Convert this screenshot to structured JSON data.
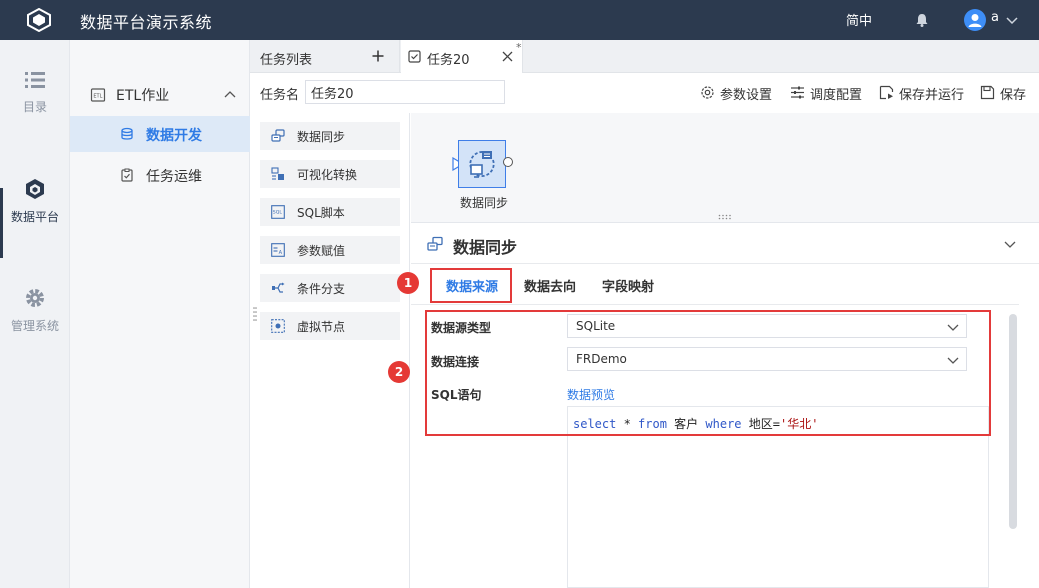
{
  "header": {
    "app_title": "数据平台演示系统",
    "lang": "简中",
    "user": "a"
  },
  "rail": {
    "items": [
      {
        "label": "目录",
        "icon": "list-icon"
      },
      {
        "label": "数据平台",
        "icon": "cube-icon",
        "active": true
      },
      {
        "label": "管理系统",
        "icon": "gear-icon"
      }
    ]
  },
  "sidebar": {
    "group": "ETL作业",
    "items": [
      {
        "label": "数据开发",
        "active": true
      },
      {
        "label": "任务运维"
      }
    ]
  },
  "tabs": {
    "list_label": "任务列表",
    "task_label": "任务20",
    "modified_mark": "*"
  },
  "toolbar": {
    "name_label": "任务名",
    "name_value": "任务20",
    "params_label": "参数设置",
    "schedule_label": "调度配置",
    "save_run_label": "保存并运行",
    "save_label": "保存"
  },
  "palette": {
    "items": [
      {
        "label": "数据同步",
        "icon": "data-sync-icon"
      },
      {
        "label": "可视化转换",
        "icon": "visual-transform-icon"
      },
      {
        "label": "SQL脚本",
        "icon": "sql-icon"
      },
      {
        "label": "参数赋值",
        "icon": "param-assign-icon"
      },
      {
        "label": "条件分支",
        "icon": "branch-icon"
      },
      {
        "label": "虚拟节点",
        "icon": "virtual-node-icon"
      }
    ]
  },
  "canvas": {
    "node_label": "数据同步"
  },
  "panel": {
    "title": "数据同步",
    "tabs": [
      {
        "label": "数据来源",
        "active": true
      },
      {
        "label": "数据去向"
      },
      {
        "label": "字段映射"
      }
    ],
    "badges": [
      "1",
      "2"
    ],
    "source_type_label": "数据源类型",
    "source_type_value": "SQLite",
    "connection_label": "数据连接",
    "connection_value": "FRDemo",
    "sql_label": "SQL语句",
    "preview_label": "数据预览",
    "sql": {
      "kw_select": "select",
      "star": " * ",
      "kw_from": "from",
      "table": " 客户 ",
      "kw_where": "where",
      "cond": " 地区=",
      "value": "'华北'"
    }
  },
  "colors": {
    "topbar": "#2c3a4f",
    "accent": "#2f7be5",
    "highlight": "#e33a3a"
  }
}
